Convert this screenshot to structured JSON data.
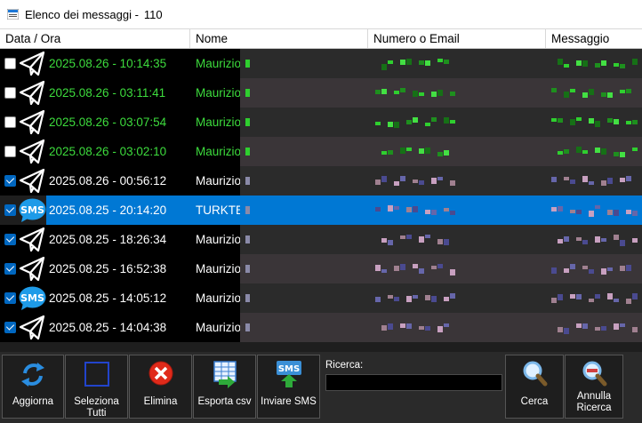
{
  "window": {
    "title": "Elenco dei messaggi -",
    "count": "110"
  },
  "columns": [
    "Data / Ora",
    "Nome",
    "Numero o Email",
    "Messaggio"
  ],
  "rows": [
    {
      "checked": false,
      "icon": "telegram-icon",
      "date": "2025.08.26 - 10:14:35",
      "name": "Maurizio",
      "color": "#3ddc3d"
    },
    {
      "checked": false,
      "icon": "telegram-icon",
      "date": "2025.08.26 - 03:11:41",
      "name": "Maurizio",
      "color": "#3ddc3d"
    },
    {
      "checked": false,
      "icon": "telegram-icon",
      "date": "2025.08.26 - 03:07:54",
      "name": "Maurizio",
      "color": "#3ddc3d"
    },
    {
      "checked": false,
      "icon": "telegram-icon",
      "date": "2025.08.26 - 03:02:10",
      "name": "Maurizio",
      "color": "#3ddc3d"
    },
    {
      "checked": true,
      "icon": "telegram-icon",
      "date": "2025.08.26 - 00:56:12",
      "name": "Maurizio",
      "color": "#ffffff"
    },
    {
      "checked": true,
      "icon": "sms-icon",
      "date": "2025.08.25 - 20:14:20",
      "name": "TURKTE",
      "color": "#ffffff",
      "selected": true
    },
    {
      "checked": true,
      "icon": "telegram-icon",
      "date": "2025.08.25 - 18:26:34",
      "name": "Maurizio",
      "color": "#ffffff"
    },
    {
      "checked": true,
      "icon": "telegram-icon",
      "date": "2025.08.25 - 16:52:38",
      "name": "Maurizio",
      "color": "#ffffff"
    },
    {
      "checked": true,
      "icon": "sms-icon",
      "date": "2025.08.25 - 14:05:12",
      "name": "Maurizio",
      "color": "#ffffff"
    },
    {
      "checked": true,
      "icon": "telegram-icon",
      "date": "2025.08.25 - 14:04:38",
      "name": "Maurizio",
      "color": "#ffffff"
    }
  ],
  "toolbar": {
    "refresh": "Aggiorna",
    "select_all": "Seleziona Tutti",
    "delete": "Elimina",
    "export": "Esporta csv",
    "send_sms": "Inviare SMS",
    "search_label": "Ricerca:",
    "search_value": "",
    "search": "Cerca",
    "cancel_search_1": "Annulla",
    "cancel_search_2": "Ricerca"
  },
  "colors": {
    "accent": "#0078d4",
    "green_text": "#3ddc3d",
    "sms_blue": "#1e9be8"
  }
}
